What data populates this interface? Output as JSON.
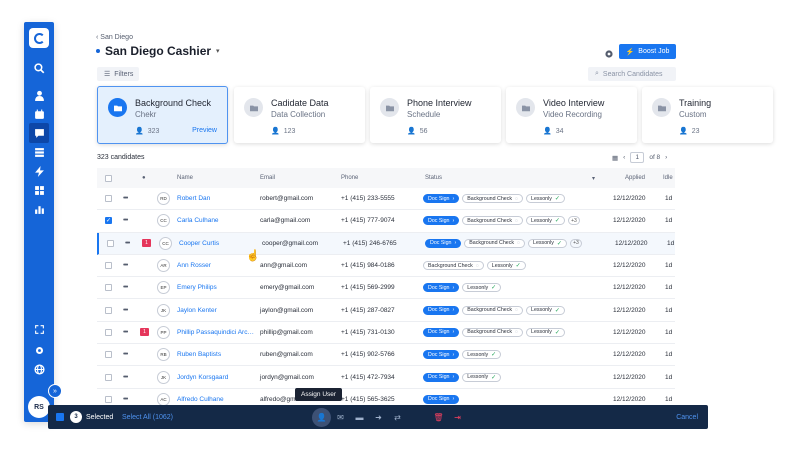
{
  "sidebar": {
    "logo": "logo-icon",
    "icons": [
      "search-icon",
      "user-icon",
      "calendar-icon",
      "chat-icon",
      "list-icon",
      "bolt-icon",
      "grid-icon",
      "bar-chart-icon"
    ],
    "bottom_icons": [
      "expand-icon",
      "gear-icon",
      "globe-icon"
    ],
    "avatar": "RS",
    "expand": "»"
  },
  "header": {
    "breadcrumb": "‹ San Diego",
    "title": "San Diego Cashier",
    "boost_label": "Boost Job",
    "filters_label": "Filters",
    "search_placeholder": "Search Candidates"
  },
  "stages": [
    {
      "title": "Background Check",
      "sub": "Chekr",
      "count": "323",
      "extra": "Preview",
      "active": true
    },
    {
      "title": "Cadidate Data",
      "sub": "Data Collection",
      "count": "123",
      "extra": "",
      "active": false
    },
    {
      "title": "Phone Interview",
      "sub": "Schedule",
      "count": "56",
      "extra": "",
      "active": false
    },
    {
      "title": "Video Interview",
      "sub": "Video Recording",
      "count": "34",
      "extra": "",
      "active": false
    },
    {
      "title": "Training",
      "sub": "Custom",
      "count": "23",
      "extra": "",
      "active": false
    }
  ],
  "table": {
    "candidate_count": "323 candidates",
    "page": "1",
    "page_total": "of 8",
    "columns": {
      "name": "Name",
      "email": "Email",
      "phone": "Phone",
      "status": "Status",
      "applied": "Applied",
      "idle": "Idle"
    },
    "rows": [
      {
        "initials": "RD",
        "name": "Robert Dan",
        "email": "robert@gmail.com",
        "phone": "+1 (415) 233-5555",
        "checked": false,
        "highlight": false,
        "badge": "",
        "tags": [
          "Doc Sign",
          "Background Check",
          "Lessonly"
        ],
        "more": "",
        "applied": "12/12/2020",
        "idle": "1d"
      },
      {
        "initials": "CC",
        "name": "Carla Culhane",
        "email": "carla@gmail.com",
        "phone": "+1 (415) 777-9074",
        "checked": true,
        "highlight": false,
        "badge": "",
        "tags": [
          "Doc Sign",
          "Background Check",
          "Lessonly"
        ],
        "more": "+3",
        "applied": "12/12/2020",
        "idle": "1d"
      },
      {
        "initials": "CC",
        "name": "Cooper Curtis",
        "email": "cooper@gmail.com",
        "phone": "+1 (415) 246-6765",
        "checked": false,
        "highlight": true,
        "badge": "1",
        "tags": [
          "Doc Sign",
          "Background Check",
          "Lessonly"
        ],
        "more": "+3",
        "applied": "12/12/2020",
        "idle": "1d"
      },
      {
        "initials": "AR",
        "name": "Ann Rosser",
        "email": "ann@gmail.com",
        "phone": "+1 (415) 984-0186",
        "checked": false,
        "highlight": false,
        "badge": "",
        "tags": [
          "Background Check",
          "Lessonly"
        ],
        "more": "",
        "applied": "12/12/2020",
        "idle": "1d"
      },
      {
        "initials": "EP",
        "name": "Emery Philips",
        "email": "emery@gmail.com",
        "phone": "+1 (415) 569-2999",
        "checked": false,
        "highlight": false,
        "badge": "",
        "tags": [
          "Doc Sign",
          "Lessonly"
        ],
        "more": "",
        "applied": "12/12/2020",
        "idle": "1d"
      },
      {
        "initials": "JK",
        "name": "Jaylon Kenter",
        "email": "jaylon@gmail.com",
        "phone": "+1 (415) 287-0827",
        "checked": false,
        "highlight": false,
        "badge": "",
        "tags": [
          "Doc Sign",
          "Background Check",
          "Lessonly"
        ],
        "more": "",
        "applied": "12/12/2020",
        "idle": "1d"
      },
      {
        "initials": "PP",
        "name": "Phillip Passaquindici Arc…",
        "email": "phillip@gmail.com",
        "phone": "+1 (415) 731-0130",
        "checked": false,
        "highlight": false,
        "badge": "1",
        "tags": [
          "Doc Sign",
          "Background Check",
          "Lessonly"
        ],
        "more": "",
        "applied": "12/12/2020",
        "idle": "1d"
      },
      {
        "initials": "RB",
        "name": "Ruben Baptists",
        "email": "ruben@gmail.com",
        "phone": "+1 (415) 902-5766",
        "checked": false,
        "highlight": false,
        "badge": "",
        "tags": [
          "Doc Sign",
          "Lessonly"
        ],
        "more": "",
        "applied": "12/12/2020",
        "idle": "1d"
      },
      {
        "initials": "JK",
        "name": "Jordyn Korsgaard",
        "email": "jordyn@gmail.com",
        "phone": "+1 (415) 472-7934",
        "checked": false,
        "highlight": false,
        "badge": "",
        "tags": [
          "Doc Sign",
          "Lessonly"
        ],
        "more": "",
        "applied": "12/12/2020",
        "idle": "1d"
      },
      {
        "initials": "AC",
        "name": "Alfredo Culhane",
        "email": "alfredo@gmail.com",
        "phone": "+1 (415) 565-3625",
        "checked": false,
        "highlight": false,
        "badge": "",
        "tags": [
          "Doc Sign"
        ],
        "more": "",
        "applied": "12/12/2020",
        "idle": "1d"
      }
    ]
  },
  "action_bar": {
    "count": "3",
    "selected_label": "Selected",
    "select_all_label": "Select All (1062)",
    "cancel_label": "Cancel",
    "tooltip": "Assign User"
  },
  "colors": {
    "accent": "#1976f0",
    "sidebar": "#1565d8",
    "action_bar": "#142947",
    "danger": "#e5365b"
  }
}
